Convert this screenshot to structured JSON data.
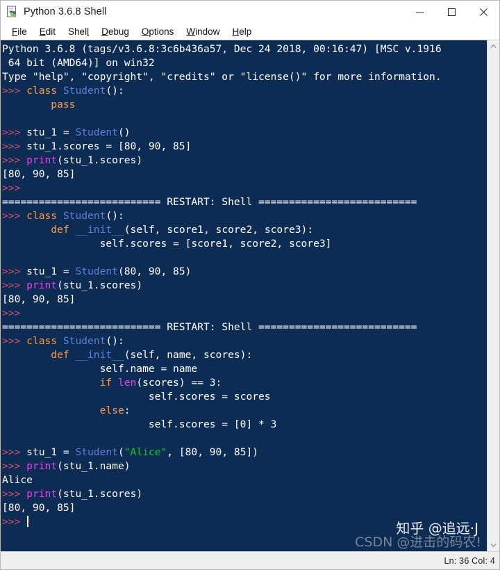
{
  "window": {
    "title": "Python 3.6.8 Shell",
    "icon": "python-idle-icon",
    "controls": {
      "minimize": "minimize-icon",
      "maximize": "maximize-icon",
      "close": "close-icon"
    }
  },
  "menubar": {
    "items": [
      {
        "label": "File",
        "acc_index": 0
      },
      {
        "label": "Edit",
        "acc_index": 0
      },
      {
        "label": "Shell",
        "acc_index": 4
      },
      {
        "label": "Debug",
        "acc_index": 0
      },
      {
        "label": "Options",
        "acc_index": 0
      },
      {
        "label": "Window",
        "acc_index": 0
      },
      {
        "label": "Help",
        "acc_index": 0
      }
    ]
  },
  "shell": {
    "banner": [
      "Python 3.6.8 (tags/v3.6.8:3c6b436a57, Dec 24 2018, 00:16:47) [MSC v.1916",
      " 64 bit (AMD64)] on win32",
      "Type \"help\", \"copyright\", \"credits\" or \"license()\" for more information."
    ],
    "restart_separator": "========================== RESTART: Shell ==========================",
    "prompt": ">>>",
    "cursor_visible": true,
    "lines": [
      ">>> class Student():",
      "        pass",
      "",
      ">>> stu_1 = Student()",
      ">>> stu_1.scores = [80, 90, 85]",
      ">>> print(stu_1.scores)",
      "[80, 90, 85]",
      ">>>",
      ">>> class Student():",
      "        def __init__(self, score1, score2, score3):",
      "                self.scores = [score1, score2, score3]",
      "",
      ">>> stu_1 = Student(80, 90, 85)",
      ">>> print(stu_1.scores)",
      "[80, 90, 85]",
      ">>>",
      ">>> class Student():",
      "        def __init__(self, name, scores):",
      "                self.name = name",
      "                if len(scores) == 3:",
      "                        self.scores = scores",
      "                else:",
      "                        self.scores = [0] * 3",
      "",
      ">>> stu_1 = Student(\"Alice\", [80, 90, 85])",
      ">>> print(stu_1.name)",
      "Alice",
      ">>> print(stu_1.scores)",
      "[80, 90, 85]",
      ">>>"
    ],
    "colors": {
      "background": "#0d2c54",
      "foreground": "#ffffff",
      "keyword": "#ff9a3c",
      "class_name": "#5f7ee0",
      "builtin": "#e740e7",
      "prompt": "#d4506a",
      "string": "#15c41f"
    }
  },
  "watermarks": {
    "zhihu": "知乎 @追远·J",
    "csdn": "CSDN @进击的码农!"
  },
  "scrollbar": {
    "up_arrow": "chevron-up-icon",
    "down_arrow": "chevron-down-icon"
  },
  "statusbar": {
    "position": "Ln: 36  Col: 4"
  }
}
